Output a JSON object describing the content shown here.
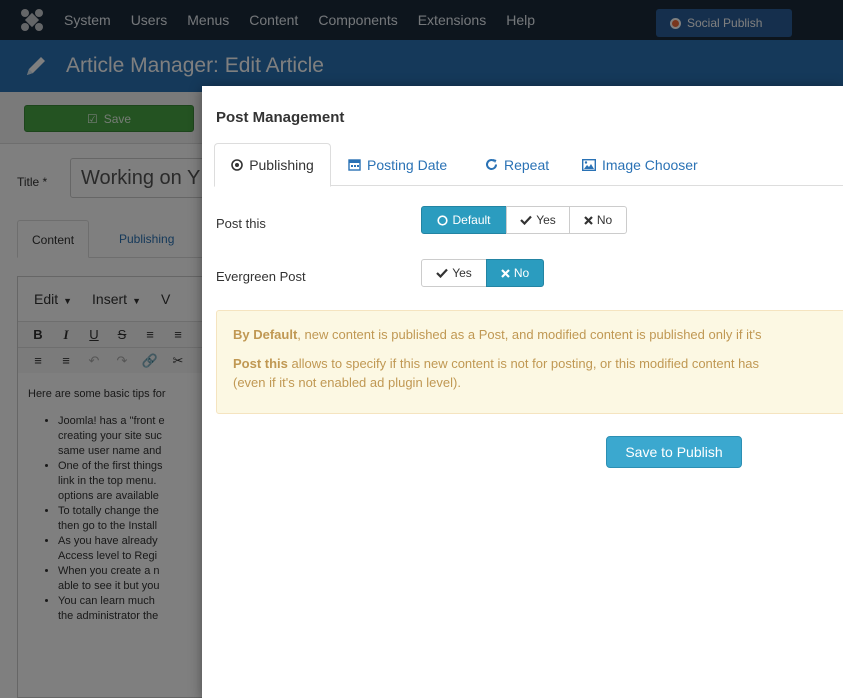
{
  "topnav": {
    "items": [
      "System",
      "Users",
      "Menus",
      "Content",
      "Components",
      "Extensions",
      "Help"
    ],
    "social_button": "Social Publish"
  },
  "titlebar": {
    "title": "Article Manager: Edit Article"
  },
  "toolbar": {
    "save_label": "Save"
  },
  "form": {
    "title_label": "Title *",
    "title_value": "Working on Y",
    "tabs": [
      "Content",
      "Publishing"
    ]
  },
  "editor": {
    "menubar": [
      "Edit",
      "Insert",
      "V"
    ],
    "intro": "Here are some basic tips for",
    "bullets": [
      [
        "Joomla! has a \"front e",
        "creating your site suc",
        "same user name and"
      ],
      [
        "One of the first things",
        "link in the top menu.",
        "options are available"
      ],
      [
        "To totally change the",
        "then go to the Install"
      ],
      [
        "As you have already",
        "Access level to Regi"
      ],
      [
        "When you create a n",
        "able to see it but you"
      ],
      [
        "You can learn much",
        "the administrator the"
      ]
    ]
  },
  "modal": {
    "title": "Post Management",
    "tabs": {
      "publishing": "Publishing",
      "posting_date": "Posting Date",
      "repeat": "Repeat",
      "image_chooser": "Image Chooser"
    },
    "post_this": {
      "label": "Post this",
      "options": [
        "Default",
        "Yes",
        "No"
      ],
      "selected": "Default"
    },
    "evergreen": {
      "label": "Evergreen Post",
      "options": [
        "Yes",
        "No"
      ],
      "selected": "No"
    },
    "info": {
      "line1_bold": "By Default",
      "line1_rest": ", new content is published as a Post, and modified content is published only if it's",
      "line2_bold": "Post this",
      "line2_rest": " allows to specify if this new content is not for posting, or this modified content has",
      "line3": "(even if it's not enabled ad plugin level)."
    },
    "submit_label": "Save to Publish"
  },
  "colors": {
    "topnav_bg": "#1b2a3a",
    "titlebar_bg": "#2a72b5",
    "save_green": "#48a745",
    "toggle_active": "#2b9cbf",
    "info_bg": "#fcf8e3",
    "info_text": "#c09853",
    "primary_button": "#3ba8cf"
  },
  "icons": {
    "logo": "joomla-logo-icon",
    "title": "pencil-icon",
    "publishing_tab": "circle-dot-icon",
    "posting_date_tab": "calendar-icon",
    "repeat_tab": "refresh-icon",
    "image_chooser_tab": "picture-icon",
    "default_option": "circle-icon",
    "yes_option": "check-icon",
    "no_option": "x-icon"
  }
}
